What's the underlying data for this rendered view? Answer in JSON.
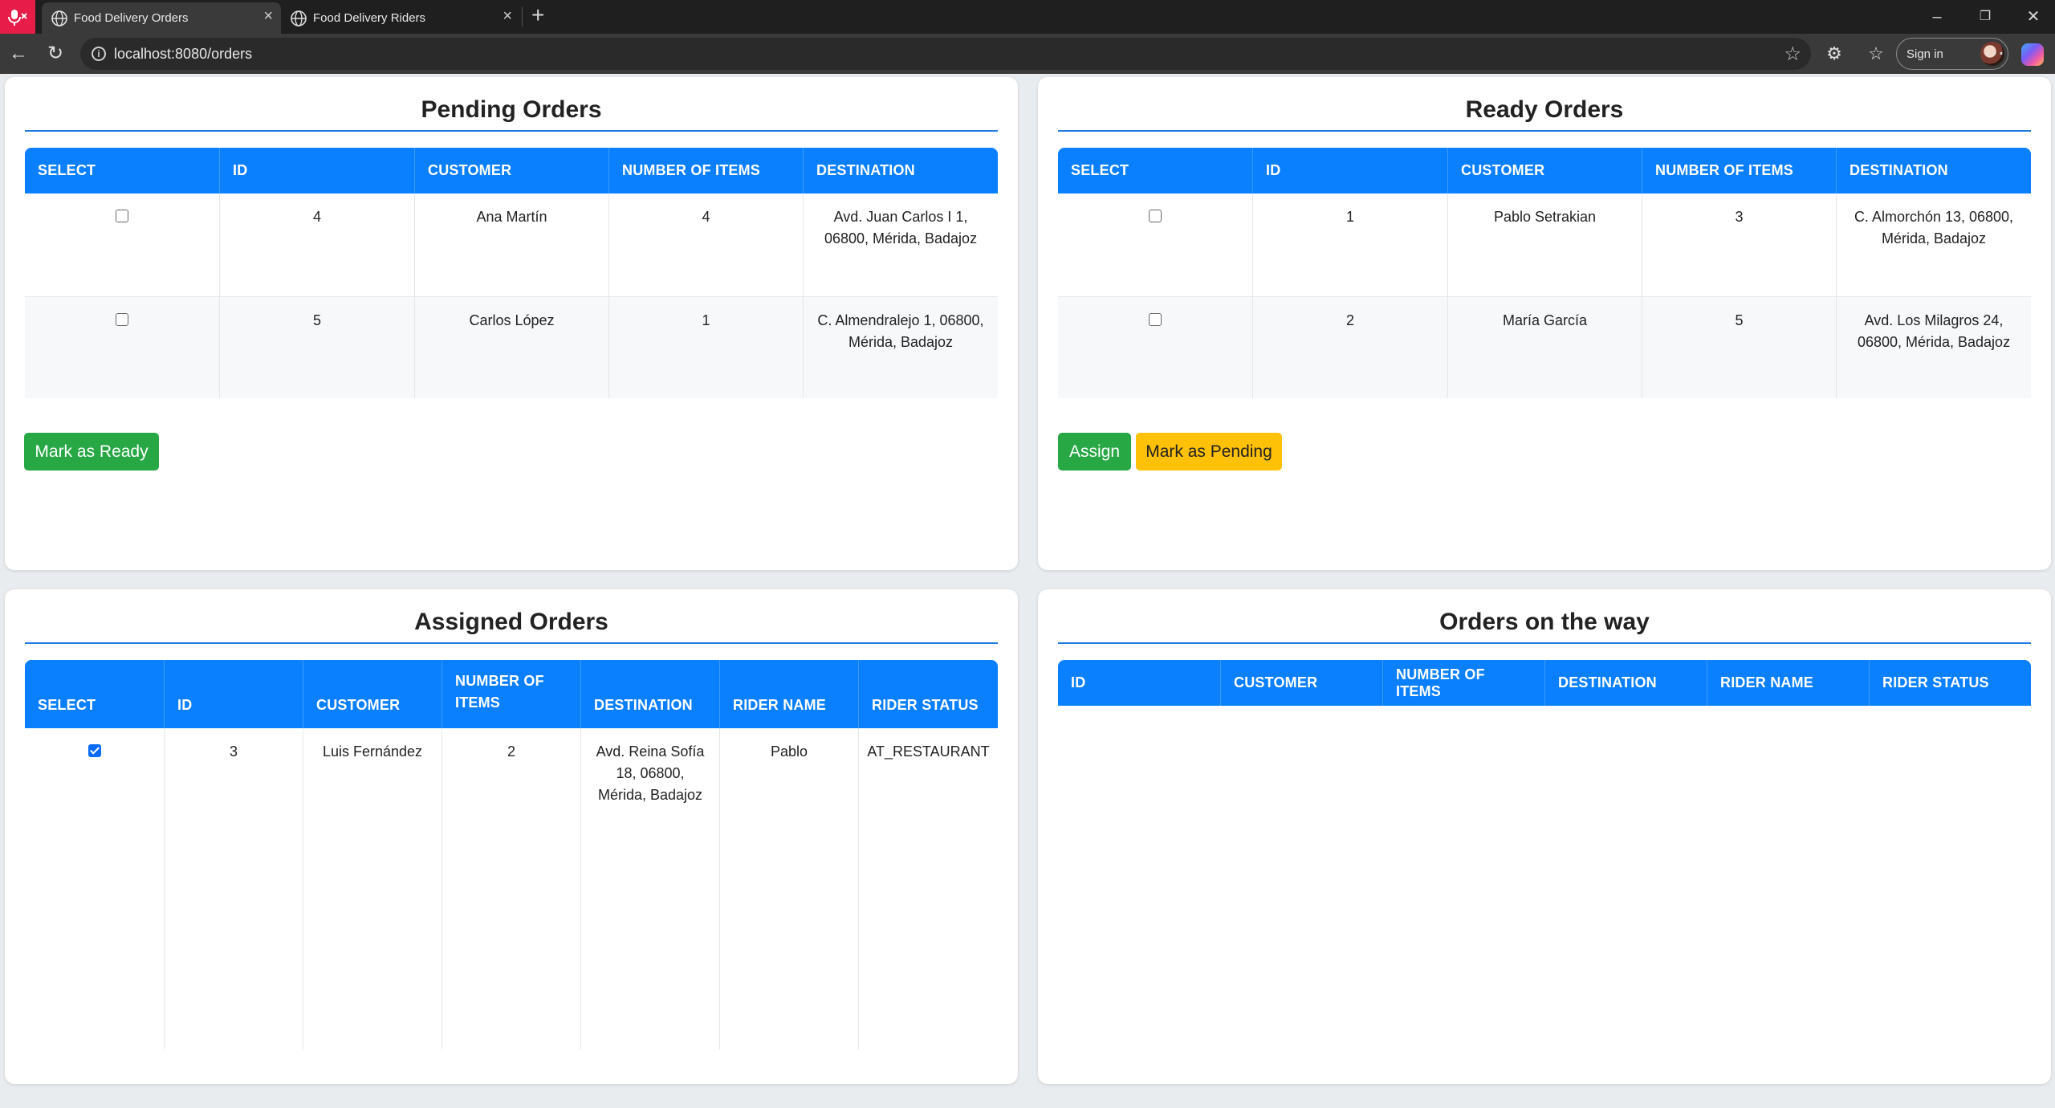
{
  "browser": {
    "tabs": [
      {
        "title": "Food Delivery Orders",
        "active": true
      },
      {
        "title": "Food Delivery Riders",
        "active": false
      }
    ],
    "url": "localhost:8080/orders",
    "sign_in_label": "Sign in"
  },
  "pending": {
    "title": "Pending Orders",
    "columns": [
      "SELECT",
      "ID",
      "CUSTOMER",
      "NUMBER OF ITEMS",
      "DESTINATION"
    ],
    "rows": [
      {
        "checked": false,
        "id": "4",
        "customer": "Ana Martín",
        "items": "4",
        "destination_line1": "Avd. Juan Carlos I 1,",
        "destination_line2": "06800, Mérida, Badajoz"
      },
      {
        "checked": false,
        "id": "5",
        "customer": "Carlos López",
        "items": "1",
        "destination_line1": "C. Almendralejo 1, 06800,",
        "destination_line2": "Mérida, Badajoz"
      }
    ],
    "button_label": "Mark as Ready"
  },
  "ready": {
    "title": "Ready Orders",
    "columns": [
      "SELECT",
      "ID",
      "CUSTOMER",
      "NUMBER OF ITEMS",
      "DESTINATION"
    ],
    "rows": [
      {
        "checked": false,
        "id": "1",
        "customer": "Pablo Setrakian",
        "items": "3",
        "destination_line1": "C. Almorchón 13, 06800,",
        "destination_line2": "Mérida, Badajoz"
      },
      {
        "checked": false,
        "id": "2",
        "customer": "María García",
        "items": "5",
        "destination_line1": "Avd. Los Milagros 24,",
        "destination_line2": "06800, Mérida, Badajoz"
      }
    ],
    "assign_label": "Assign",
    "pending_label": "Mark as Pending"
  },
  "assigned": {
    "title": "Assigned Orders",
    "columns": [
      "SELECT",
      "ID",
      "CUSTOMER",
      "NUMBER OF ITEMS",
      "DESTINATION",
      "RIDER NAME",
      "RIDER STATUS"
    ],
    "items_header_line1": "NUMBER OF",
    "items_header_line2": "ITEMS",
    "rows": [
      {
        "checked": true,
        "id": "3",
        "customer": "Luis Fernández",
        "items": "2",
        "destination_line1": "Avd. Reina Sofía",
        "destination_line2": "18, 06800,",
        "destination_line3": "Mérida, Badajoz",
        "rider_name": "Pablo",
        "rider_status": "AT_RESTAURANT"
      }
    ]
  },
  "on_the_way": {
    "title": "Orders on the way",
    "columns": [
      "ID",
      "CUSTOMER",
      "NUMBER OF ITEMS",
      "DESTINATION",
      "RIDER NAME",
      "RIDER STATUS"
    ]
  },
  "colors": {
    "header_blue": "#0a80ff",
    "green_button": "#28a745",
    "yellow_button": "#ffc107"
  }
}
